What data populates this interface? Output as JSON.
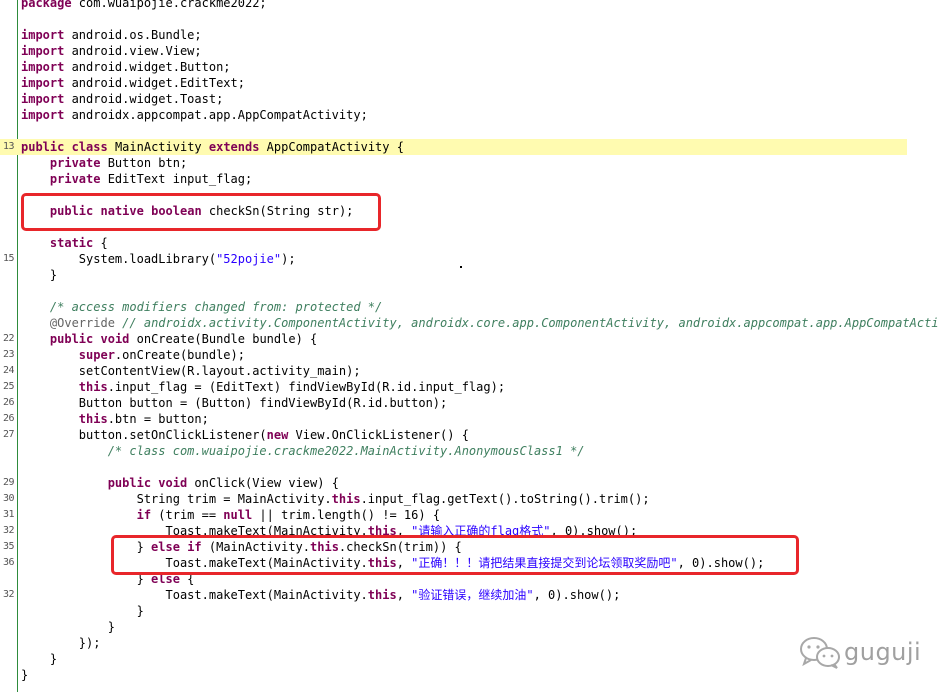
{
  "lines": [
    {
      "n": "",
      "hl": false,
      "tokens": [
        {
          "t": "k",
          "v": "package"
        },
        {
          "t": "p",
          "v": " com.wuaipojie.crackme2022;"
        }
      ]
    },
    {
      "n": "",
      "hl": false,
      "tokens": []
    },
    {
      "n": "",
      "hl": false,
      "tokens": [
        {
          "t": "k",
          "v": "import"
        },
        {
          "t": "p",
          "v": " android.os.Bundle;"
        }
      ]
    },
    {
      "n": "",
      "hl": false,
      "tokens": [
        {
          "t": "k",
          "v": "import"
        },
        {
          "t": "p",
          "v": " android.view.View;"
        }
      ]
    },
    {
      "n": "",
      "hl": false,
      "tokens": [
        {
          "t": "k",
          "v": "import"
        },
        {
          "t": "p",
          "v": " android.widget.Button;"
        }
      ]
    },
    {
      "n": "",
      "hl": false,
      "tokens": [
        {
          "t": "k",
          "v": "import"
        },
        {
          "t": "p",
          "v": " android.widget.EditText;"
        }
      ]
    },
    {
      "n": "",
      "hl": false,
      "tokens": [
        {
          "t": "k",
          "v": "import"
        },
        {
          "t": "p",
          "v": " android.widget.Toast;"
        }
      ]
    },
    {
      "n": "",
      "hl": false,
      "tokens": [
        {
          "t": "k",
          "v": "import"
        },
        {
          "t": "p",
          "v": " androidx.appcompat.app.AppCompatActivity;"
        }
      ]
    },
    {
      "n": "",
      "hl": false,
      "tokens": []
    },
    {
      "n": "13",
      "hl": true,
      "tokens": [
        {
          "t": "k",
          "v": "public"
        },
        {
          "t": "p",
          "v": " "
        },
        {
          "t": "k",
          "v": "class"
        },
        {
          "t": "p",
          "v": " MainActivity "
        },
        {
          "t": "k",
          "v": "extends"
        },
        {
          "t": "p",
          "v": " AppCompatActivity {"
        }
      ]
    },
    {
      "n": "",
      "hl": false,
      "tokens": [
        {
          "t": "p",
          "v": "    "
        },
        {
          "t": "k",
          "v": "private"
        },
        {
          "t": "p",
          "v": " Button btn;"
        }
      ]
    },
    {
      "n": "",
      "hl": false,
      "tokens": [
        {
          "t": "p",
          "v": "    "
        },
        {
          "t": "k",
          "v": "private"
        },
        {
          "t": "p",
          "v": " EditText input_flag;"
        }
      ]
    },
    {
      "n": "",
      "hl": false,
      "tokens": []
    },
    {
      "n": "",
      "hl": false,
      "tokens": [
        {
          "t": "p",
          "v": "    "
        },
        {
          "t": "k",
          "v": "public"
        },
        {
          "t": "p",
          "v": " "
        },
        {
          "t": "k",
          "v": "native"
        },
        {
          "t": "p",
          "v": " "
        },
        {
          "t": "k",
          "v": "boolean"
        },
        {
          "t": "p",
          "v": " checkSn(String str);"
        }
      ]
    },
    {
      "n": "",
      "hl": false,
      "tokens": []
    },
    {
      "n": "",
      "hl": false,
      "tokens": [
        {
          "t": "p",
          "v": "    "
        },
        {
          "t": "k",
          "v": "static"
        },
        {
          "t": "p",
          "v": " {"
        }
      ]
    },
    {
      "n": "15",
      "hl": false,
      "tokens": [
        {
          "t": "p",
          "v": "        System.loadLibrary("
        },
        {
          "t": "s",
          "v": "\"52pojie\""
        },
        {
          "t": "p",
          "v": ");"
        }
      ]
    },
    {
      "n": "",
      "hl": false,
      "tokens": [
        {
          "t": "p",
          "v": "    }"
        }
      ]
    },
    {
      "n": "",
      "hl": false,
      "tokens": []
    },
    {
      "n": "",
      "hl": false,
      "tokens": [
        {
          "t": "p",
          "v": "    "
        },
        {
          "t": "c",
          "v": "/* access modifiers changed from: protected */"
        }
      ]
    },
    {
      "n": "",
      "hl": false,
      "tokens": [
        {
          "t": "p",
          "v": "    "
        },
        {
          "t": "ann",
          "v": "@Override"
        },
        {
          "t": "p",
          "v": " "
        },
        {
          "t": "c",
          "v": "// androidx.activity.ComponentActivity, androidx.core.app.ComponentActivity, androidx.appcompat.app.AppCompatActi"
        }
      ]
    },
    {
      "n": "22",
      "hl": false,
      "tokens": [
        {
          "t": "p",
          "v": "    "
        },
        {
          "t": "k",
          "v": "public"
        },
        {
          "t": "p",
          "v": " "
        },
        {
          "t": "k",
          "v": "void"
        },
        {
          "t": "p",
          "v": " onCreate(Bundle bundle) {"
        }
      ]
    },
    {
      "n": "23",
      "hl": false,
      "tokens": [
        {
          "t": "p",
          "v": "        "
        },
        {
          "t": "k",
          "v": "super"
        },
        {
          "t": "p",
          "v": ".onCreate(bundle);"
        }
      ]
    },
    {
      "n": "24",
      "hl": false,
      "tokens": [
        {
          "t": "p",
          "v": "        setContentView(R.layout.activity_main);"
        }
      ]
    },
    {
      "n": "25",
      "hl": false,
      "tokens": [
        {
          "t": "p",
          "v": "        "
        },
        {
          "t": "k",
          "v": "this"
        },
        {
          "t": "p",
          "v": ".input_flag = (EditText) findViewById(R.id.input_flag);"
        }
      ]
    },
    {
      "n": "26",
      "hl": false,
      "tokens": [
        {
          "t": "p",
          "v": "        Button button = (Button) findViewById(R.id.button);"
        }
      ]
    },
    {
      "n": "26",
      "hl": false,
      "tokens": [
        {
          "t": "p",
          "v": "        "
        },
        {
          "t": "k",
          "v": "this"
        },
        {
          "t": "p",
          "v": ".btn = button;"
        }
      ]
    },
    {
      "n": "27",
      "hl": false,
      "tokens": [
        {
          "t": "p",
          "v": "        button.setOnClickListener("
        },
        {
          "t": "k",
          "v": "new"
        },
        {
          "t": "p",
          "v": " View.OnClickListener() {"
        }
      ]
    },
    {
      "n": "",
      "hl": false,
      "tokens": [
        {
          "t": "p",
          "v": "            "
        },
        {
          "t": "c",
          "v": "/* class com.wuaipojie.crackme2022.MainActivity.AnonymousClass1 */"
        }
      ]
    },
    {
      "n": "",
      "hl": false,
      "tokens": []
    },
    {
      "n": "29",
      "hl": false,
      "tokens": [
        {
          "t": "p",
          "v": "            "
        },
        {
          "t": "k",
          "v": "public"
        },
        {
          "t": "p",
          "v": " "
        },
        {
          "t": "k",
          "v": "void"
        },
        {
          "t": "p",
          "v": " onClick(View view) {"
        }
      ]
    },
    {
      "n": "30",
      "hl": false,
      "tokens": [
        {
          "t": "p",
          "v": "                String trim = MainActivity."
        },
        {
          "t": "k",
          "v": "this"
        },
        {
          "t": "p",
          "v": ".input_flag.getText().toString().trim();"
        }
      ]
    },
    {
      "n": "31",
      "hl": false,
      "tokens": [
        {
          "t": "p",
          "v": "                "
        },
        {
          "t": "k",
          "v": "if"
        },
        {
          "t": "p",
          "v": " (trim == "
        },
        {
          "t": "k",
          "v": "null"
        },
        {
          "t": "p",
          "v": " || trim.length() != 16) {"
        }
      ]
    },
    {
      "n": "32",
      "hl": false,
      "tokens": [
        {
          "t": "p",
          "v": "                    Toast.makeText(MainActivity."
        },
        {
          "t": "k",
          "v": "this"
        },
        {
          "t": "p",
          "v": ", "
        },
        {
          "t": "s",
          "v": "\"请输入正确的flag格式\""
        },
        {
          "t": "p",
          "v": ", 0).show();"
        }
      ]
    },
    {
      "n": "35",
      "hl": false,
      "tokens": [
        {
          "t": "p",
          "v": "                } "
        },
        {
          "t": "k",
          "v": "else"
        },
        {
          "t": "p",
          "v": " "
        },
        {
          "t": "k",
          "v": "if"
        },
        {
          "t": "p",
          "v": " (MainActivity."
        },
        {
          "t": "k",
          "v": "this"
        },
        {
          "t": "p",
          "v": ".checkSn(trim)) {"
        }
      ]
    },
    {
      "n": "36",
      "hl": false,
      "tokens": [
        {
          "t": "p",
          "v": "                    Toast.makeText(MainActivity."
        },
        {
          "t": "k",
          "v": "this"
        },
        {
          "t": "p",
          "v": ", "
        },
        {
          "t": "s",
          "v": "\"正确！！！请把结果直接提交到论坛领取奖励吧\""
        },
        {
          "t": "p",
          "v": ", 0).show();"
        }
      ]
    },
    {
      "n": "",
      "hl": false,
      "tokens": [
        {
          "t": "p",
          "v": "                } "
        },
        {
          "t": "k",
          "v": "else"
        },
        {
          "t": "p",
          "v": " {"
        }
      ]
    },
    {
      "n": "32",
      "hl": false,
      "tokens": [
        {
          "t": "p",
          "v": "                    Toast.makeText(MainActivity."
        },
        {
          "t": "k",
          "v": "this"
        },
        {
          "t": "p",
          "v": ", "
        },
        {
          "t": "s",
          "v": "\"验证错误，继续加油\""
        },
        {
          "t": "p",
          "v": ", 0).show();"
        }
      ]
    },
    {
      "n": "",
      "hl": false,
      "tokens": [
        {
          "t": "p",
          "v": "                }"
        }
      ]
    },
    {
      "n": "",
      "hl": false,
      "tokens": [
        {
          "t": "p",
          "v": "            }"
        }
      ]
    },
    {
      "n": "",
      "hl": false,
      "tokens": [
        {
          "t": "p",
          "v": "        });"
        }
      ]
    },
    {
      "n": "",
      "hl": false,
      "tokens": [
        {
          "t": "p",
          "v": "    }"
        }
      ]
    },
    {
      "n": "",
      "hl": false,
      "tokens": [
        {
          "t": "p",
          "v": "}"
        }
      ]
    }
  ],
  "watermark": {
    "text": "guguji",
    "icon": "wechat-icon"
  },
  "colors": {
    "annotation_box": "#e8262a",
    "highlight_line": "#fffbb0",
    "keyword": "#7f0055",
    "string": "#2a00ff",
    "comment": "#3f7f5f"
  }
}
